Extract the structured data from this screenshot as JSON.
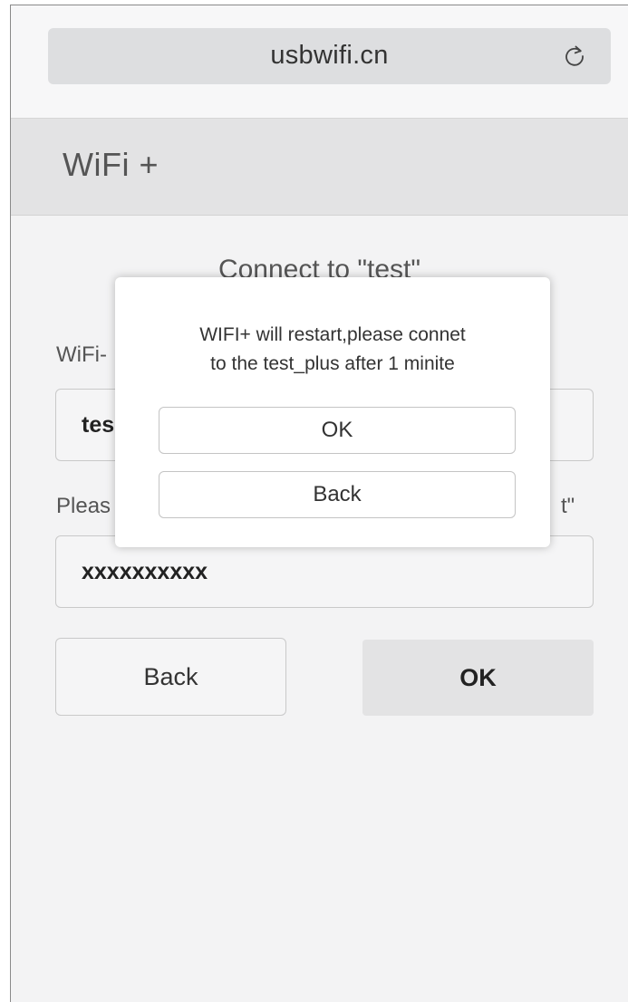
{
  "browser": {
    "url": "usbwifi.cn",
    "refresh_icon": "refresh-icon"
  },
  "header": {
    "title": "WiFi +"
  },
  "form": {
    "heading": "Connect to  \"test\"",
    "ssid_label": "WiFi-",
    "ssid_value": "tes",
    "password_label_left": "Pleas",
    "password_label_right": "t\"",
    "password_value": "xxxxxxxxxx",
    "back_label": "Back",
    "ok_label": "OK"
  },
  "dialog": {
    "message_line1": "WIFI+ will restart,please connet",
    "message_line2": "to the test_plus after 1 minite",
    "ok_label": "OK",
    "back_label": "Back"
  }
}
